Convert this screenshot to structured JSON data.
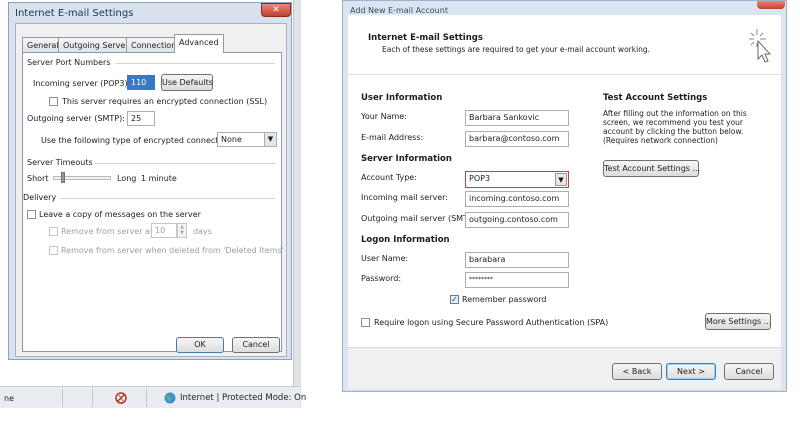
{
  "left_dialog": {
    "title": "Internet E-mail Settings",
    "close_glyph": "✕",
    "tabs": [
      {
        "label": "General"
      },
      {
        "label": "Outgoing Server"
      },
      {
        "label": "Connection"
      },
      {
        "label": "Advanced"
      }
    ],
    "server_port_numbers": {
      "heading": "Server Port Numbers",
      "incoming_label": "Incoming server (POP3):",
      "incoming_value": "110",
      "use_defaults_label": "Use Defaults",
      "ssl_label": "This server requires an encrypted connection (SSL)",
      "outgoing_label": "Outgoing server (SMTP):",
      "outgoing_value": "25",
      "encryption_label": "Use the following type of encrypted connection:",
      "encryption_value": "None"
    },
    "server_timeouts": {
      "heading": "Server Timeouts",
      "short_label": "Short",
      "long_label": "Long",
      "value_text": "1 minute",
      "slider_position": 0.15
    },
    "delivery": {
      "heading": "Delivery",
      "leave_copy_label": "Leave a copy of messages on the server",
      "remove_after_label": "Remove from server after",
      "days_value": "10",
      "days_label": "days",
      "remove_deleted_label": "Remove from server when deleted from 'Deleted Items'"
    },
    "ok_label": "OK",
    "cancel_label": "Cancel"
  },
  "status_bar": {
    "left_text": "ne",
    "zone_text": "Internet | Protected Mode: On"
  },
  "right_dialog": {
    "title": "Add New E-mail Account",
    "header_title": "Internet E-mail Settings",
    "header_subtitle": "Each of these settings are required to get your e-mail account working.",
    "user_info": {
      "heading": "User Information",
      "name_label": "Your Name:",
      "name_value": "Barbara Sankovic",
      "email_label": "E-mail Address:",
      "email_value": "barbara@contoso.com"
    },
    "server_info": {
      "heading": "Server Information",
      "account_type_label": "Account Type:",
      "account_type_value": "POP3",
      "incoming_label": "Incoming mail server:",
      "incoming_value": "incoming.contoso.com",
      "outgoing_label": "Outgoing mail server (SMTP):",
      "outgoing_value": "outgoing.contoso.com"
    },
    "logon_info": {
      "heading": "Logon Information",
      "username_label": "User Name:",
      "username_value": "barabara",
      "password_label": "Password:",
      "password_value": "********",
      "remember_label": "Remember password"
    },
    "spa_label": "Require logon using Secure Password Authentication (SPA)",
    "test_settings": {
      "heading": "Test Account Settings",
      "description": "After filling out the information on this screen, we recommend you test your account by clicking the button below. (Requires network connection)",
      "button_label": "Test Account Settings ..."
    },
    "more_settings_label": "More Settings ...",
    "back_label": "< Back",
    "next_label": "Next >",
    "cancel_label": "Cancel"
  },
  "colors": {
    "window_frame": "#d8e2ee",
    "close_button": "#c2402d",
    "account_type_border": "#d23b3b",
    "primary_button_border": "#3c7fb1"
  }
}
